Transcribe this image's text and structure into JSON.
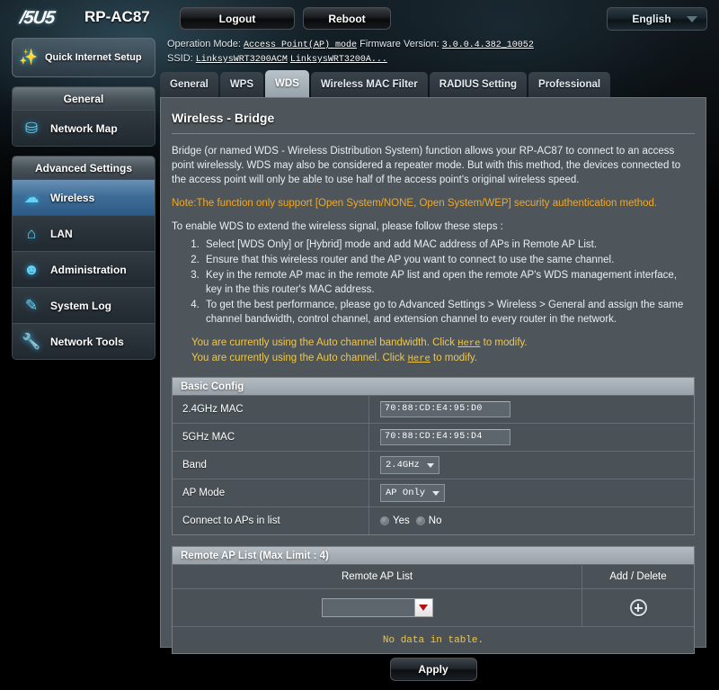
{
  "header": {
    "brand": "/5U5",
    "brand_text": "ASUS",
    "model": "RP-AC87",
    "logout_label": "Logout",
    "reboot_label": "Reboot",
    "language": "English",
    "quick_internet_setup": "Quick Internet Setup"
  },
  "status": {
    "operation_mode_label": "Operation Mode:",
    "operation_mode_value": "Access Point(AP) mode",
    "firmware_label": "Firmware Version:",
    "firmware_value": "3.0.0.4.382_10052",
    "ssid_label": "SSID:",
    "ssid_value_1": "LinksysWRT3200ACM",
    "ssid_value_2": "LinksysWRT3200A..."
  },
  "sidebar": {
    "general": {
      "title": "General",
      "items": [
        {
          "label": "Network Map",
          "icon": "network-map-icon",
          "active": false
        }
      ]
    },
    "advanced": {
      "title": "Advanced Settings",
      "items": [
        {
          "label": "Wireless",
          "icon": "wifi-icon",
          "active": true
        },
        {
          "label": "LAN",
          "icon": "home-icon",
          "active": false
        },
        {
          "label": "Administration",
          "icon": "user-icon",
          "active": false
        },
        {
          "label": "System Log",
          "icon": "log-icon",
          "active": false
        },
        {
          "label": "Network Tools",
          "icon": "wrench-icon",
          "active": false
        }
      ]
    }
  },
  "tabs": [
    {
      "label": "General",
      "active": false
    },
    {
      "label": "WPS",
      "active": false
    },
    {
      "label": "WDS",
      "active": true
    },
    {
      "label": "Wireless MAC Filter",
      "active": false
    },
    {
      "label": "RADIUS Setting",
      "active": false
    },
    {
      "label": "Professional",
      "active": false
    }
  ],
  "page": {
    "title": "Wireless - Bridge",
    "description": "Bridge (or named WDS - Wireless Distribution System) function allows your RP-AC87 to connect to an access point wirelessly. WDS may also be considered a repeater mode. But with this method, the devices connected to the access point will only be able to use half of the access point's original wireless speed.",
    "note": "Note:The function only support [Open System/NONE, Open System/WEP] security authentication method.",
    "steps_lead": "To enable WDS to extend the wireless signal, please follow these steps :",
    "steps": [
      "Select [WDS Only] or [Hybrid] mode and add MAC address of APs in Remote AP List.",
      "Ensure that this wireless router and the AP you want to connect to use the same channel.",
      "Key in the remote AP mac in the remote AP list and open the remote AP's WDS management interface, key in the this router's MAC address.",
      "To get the best performance, please go to Advanced Settings > Wireless > General and assign the same channel bandwidth, control channel, and extension channel to every router in the network."
    ],
    "warnings": [
      {
        "prefix": "You are currently using the Auto channel bandwidth. Click ",
        "link": "Here",
        "suffix": " to modify."
      },
      {
        "prefix": "You are currently using the Auto channel. Click ",
        "link": "Here",
        "suffix": " to modify."
      }
    ]
  },
  "basic_config": {
    "title": "Basic Config",
    "mac_24_label": "2.4GHz MAC",
    "mac_24_value": "70:88:CD:E4:95:D0",
    "mac_5_label": "5GHz MAC",
    "mac_5_value": "70:88:CD:E4:95:D4",
    "band_label": "Band",
    "band_value": "2.4GHz",
    "ap_mode_label": "AP Mode",
    "ap_mode_value": "AP Only",
    "connect_label": "Connect to APs in list",
    "radio_yes": "Yes",
    "radio_no": "No"
  },
  "remote_ap": {
    "title": "Remote AP List (Max Limit : 4)",
    "col_list": "Remote AP List",
    "col_action": "Add / Delete",
    "input_value": "",
    "empty_text": "No data in table."
  },
  "footer": {
    "apply_label": "Apply"
  }
}
